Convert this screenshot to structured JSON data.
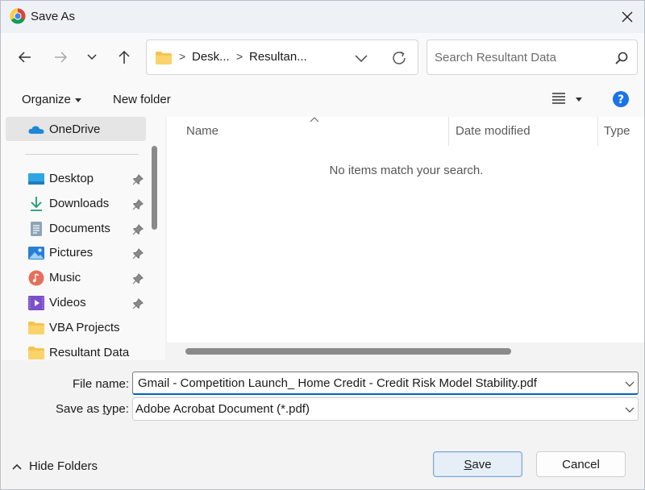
{
  "window": {
    "title": "Save As",
    "app_icon": "chrome-icon"
  },
  "nav": {
    "back_icon": "arrow-left-icon",
    "forward_icon": "arrow-right-icon",
    "recent_icon": "chevron-down-icon",
    "up_icon": "arrow-up-icon"
  },
  "address": {
    "crumbs": [
      "Desk...",
      "Resultan..."
    ],
    "separator": ">",
    "refresh_icon": "refresh-icon"
  },
  "search": {
    "placeholder": "Search Resultant Data",
    "icon": "search-icon"
  },
  "toolbar": {
    "organize_label": "Organize",
    "new_folder_label": "New folder",
    "view_icon": "list-view-icon",
    "help_icon": "help-icon"
  },
  "sidebar": {
    "items": [
      {
        "label": "OneDrive",
        "icon": "onedrive-icon",
        "pinned": false,
        "selected": true
      },
      {
        "label": "Desktop",
        "icon": "desktop-icon",
        "pinned": true
      },
      {
        "label": "Downloads",
        "icon": "download-icon",
        "pinned": true
      },
      {
        "label": "Documents",
        "icon": "documents-icon",
        "pinned": true
      },
      {
        "label": "Pictures",
        "icon": "pictures-icon",
        "pinned": true
      },
      {
        "label": "Music",
        "icon": "music-icon",
        "pinned": true
      },
      {
        "label": "Videos",
        "icon": "videos-icon",
        "pinned": true
      },
      {
        "label": "VBA Projects",
        "icon": "folder-icon",
        "pinned": false
      },
      {
        "label": "Resultant Data",
        "icon": "folder-icon",
        "pinned": false
      }
    ]
  },
  "content": {
    "columns": [
      "Name",
      "Date modified",
      "Type"
    ],
    "empty_message": "No items match your search."
  },
  "form": {
    "file_name_label": "File name:",
    "file_name_value": "Gmail - Competition Launch_ Home Credit - Credit Risk Model Stability.pdf",
    "type_label_prefix": "Save as ",
    "type_label_accel": "t",
    "type_label_suffix": "ype:",
    "type_value": "Adobe Acrobat Document (*.pdf)"
  },
  "footer": {
    "hide_folders_label": "Hide Folders",
    "save_accel": "S",
    "save_rest": "ave",
    "cancel_label": "Cancel"
  },
  "colors": {
    "accent": "#0067c0",
    "folder": "#f4c44e",
    "help": "#1a73e8"
  }
}
